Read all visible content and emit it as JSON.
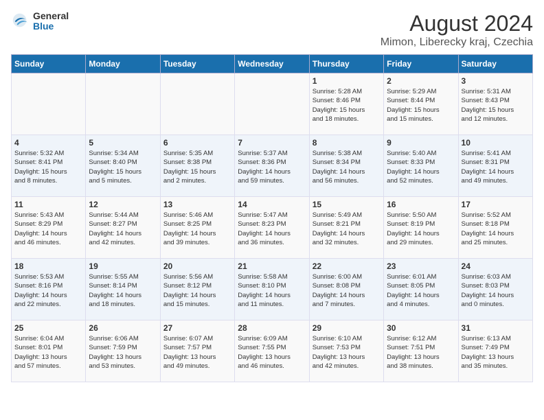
{
  "logo": {
    "general": "General",
    "blue": "Blue"
  },
  "title": "August 2024",
  "subtitle": "Mimon, Liberecky kraj, Czechia",
  "headers": [
    "Sunday",
    "Monday",
    "Tuesday",
    "Wednesday",
    "Thursday",
    "Friday",
    "Saturday"
  ],
  "weeks": [
    [
      {
        "day": "",
        "info": ""
      },
      {
        "day": "",
        "info": ""
      },
      {
        "day": "",
        "info": ""
      },
      {
        "day": "",
        "info": ""
      },
      {
        "day": "1",
        "info": "Sunrise: 5:28 AM\nSunset: 8:46 PM\nDaylight: 15 hours\nand 18 minutes."
      },
      {
        "day": "2",
        "info": "Sunrise: 5:29 AM\nSunset: 8:44 PM\nDaylight: 15 hours\nand 15 minutes."
      },
      {
        "day": "3",
        "info": "Sunrise: 5:31 AM\nSunset: 8:43 PM\nDaylight: 15 hours\nand 12 minutes."
      }
    ],
    [
      {
        "day": "4",
        "info": "Sunrise: 5:32 AM\nSunset: 8:41 PM\nDaylight: 15 hours\nand 8 minutes."
      },
      {
        "day": "5",
        "info": "Sunrise: 5:34 AM\nSunset: 8:40 PM\nDaylight: 15 hours\nand 5 minutes."
      },
      {
        "day": "6",
        "info": "Sunrise: 5:35 AM\nSunset: 8:38 PM\nDaylight: 15 hours\nand 2 minutes."
      },
      {
        "day": "7",
        "info": "Sunrise: 5:37 AM\nSunset: 8:36 PM\nDaylight: 14 hours\nand 59 minutes."
      },
      {
        "day": "8",
        "info": "Sunrise: 5:38 AM\nSunset: 8:34 PM\nDaylight: 14 hours\nand 56 minutes."
      },
      {
        "day": "9",
        "info": "Sunrise: 5:40 AM\nSunset: 8:33 PM\nDaylight: 14 hours\nand 52 minutes."
      },
      {
        "day": "10",
        "info": "Sunrise: 5:41 AM\nSunset: 8:31 PM\nDaylight: 14 hours\nand 49 minutes."
      }
    ],
    [
      {
        "day": "11",
        "info": "Sunrise: 5:43 AM\nSunset: 8:29 PM\nDaylight: 14 hours\nand 46 minutes."
      },
      {
        "day": "12",
        "info": "Sunrise: 5:44 AM\nSunset: 8:27 PM\nDaylight: 14 hours\nand 42 minutes."
      },
      {
        "day": "13",
        "info": "Sunrise: 5:46 AM\nSunset: 8:25 PM\nDaylight: 14 hours\nand 39 minutes."
      },
      {
        "day": "14",
        "info": "Sunrise: 5:47 AM\nSunset: 8:23 PM\nDaylight: 14 hours\nand 36 minutes."
      },
      {
        "day": "15",
        "info": "Sunrise: 5:49 AM\nSunset: 8:21 PM\nDaylight: 14 hours\nand 32 minutes."
      },
      {
        "day": "16",
        "info": "Sunrise: 5:50 AM\nSunset: 8:19 PM\nDaylight: 14 hours\nand 29 minutes."
      },
      {
        "day": "17",
        "info": "Sunrise: 5:52 AM\nSunset: 8:18 PM\nDaylight: 14 hours\nand 25 minutes."
      }
    ],
    [
      {
        "day": "18",
        "info": "Sunrise: 5:53 AM\nSunset: 8:16 PM\nDaylight: 14 hours\nand 22 minutes."
      },
      {
        "day": "19",
        "info": "Sunrise: 5:55 AM\nSunset: 8:14 PM\nDaylight: 14 hours\nand 18 minutes."
      },
      {
        "day": "20",
        "info": "Sunrise: 5:56 AM\nSunset: 8:12 PM\nDaylight: 14 hours\nand 15 minutes."
      },
      {
        "day": "21",
        "info": "Sunrise: 5:58 AM\nSunset: 8:10 PM\nDaylight: 14 hours\nand 11 minutes."
      },
      {
        "day": "22",
        "info": "Sunrise: 6:00 AM\nSunset: 8:08 PM\nDaylight: 14 hours\nand 7 minutes."
      },
      {
        "day": "23",
        "info": "Sunrise: 6:01 AM\nSunset: 8:05 PM\nDaylight: 14 hours\nand 4 minutes."
      },
      {
        "day": "24",
        "info": "Sunrise: 6:03 AM\nSunset: 8:03 PM\nDaylight: 14 hours\nand 0 minutes."
      }
    ],
    [
      {
        "day": "25",
        "info": "Sunrise: 6:04 AM\nSunset: 8:01 PM\nDaylight: 13 hours\nand 57 minutes."
      },
      {
        "day": "26",
        "info": "Sunrise: 6:06 AM\nSunset: 7:59 PM\nDaylight: 13 hours\nand 53 minutes."
      },
      {
        "day": "27",
        "info": "Sunrise: 6:07 AM\nSunset: 7:57 PM\nDaylight: 13 hours\nand 49 minutes."
      },
      {
        "day": "28",
        "info": "Sunrise: 6:09 AM\nSunset: 7:55 PM\nDaylight: 13 hours\nand 46 minutes."
      },
      {
        "day": "29",
        "info": "Sunrise: 6:10 AM\nSunset: 7:53 PM\nDaylight: 13 hours\nand 42 minutes."
      },
      {
        "day": "30",
        "info": "Sunrise: 6:12 AM\nSunset: 7:51 PM\nDaylight: 13 hours\nand 38 minutes."
      },
      {
        "day": "31",
        "info": "Sunrise: 6:13 AM\nSunset: 7:49 PM\nDaylight: 13 hours\nand 35 minutes."
      }
    ]
  ]
}
